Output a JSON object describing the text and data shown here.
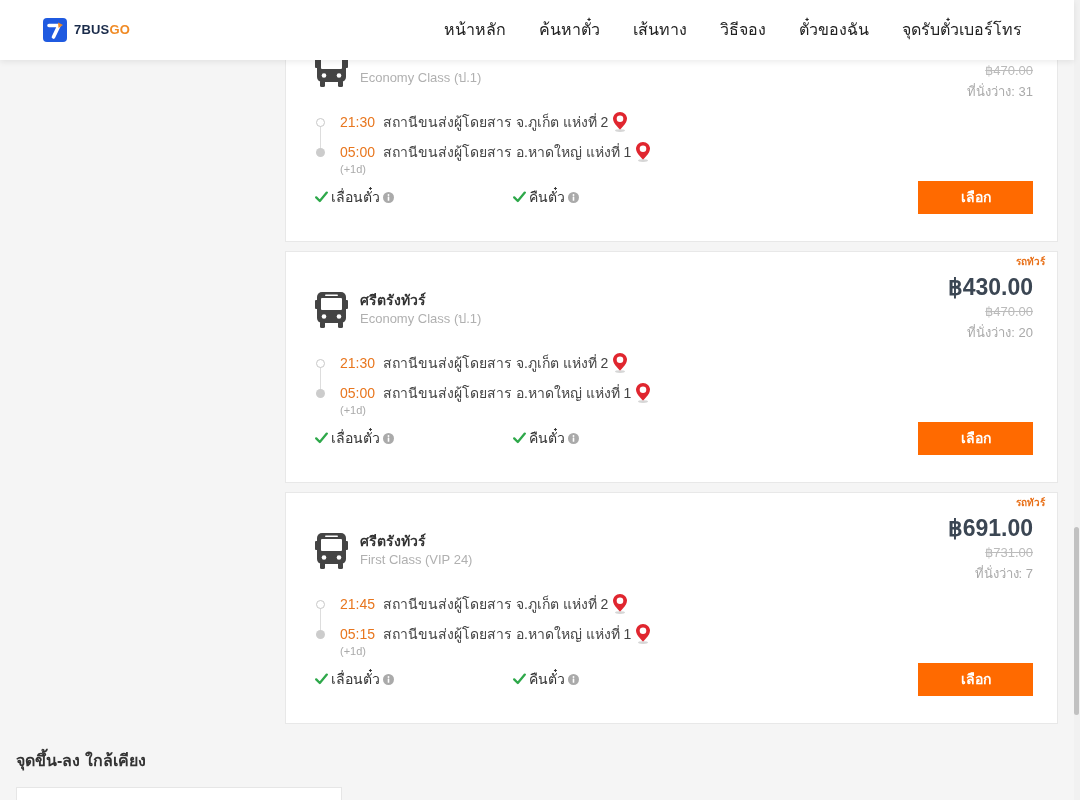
{
  "header": {
    "logo": {
      "brand": "7BUS",
      "accent": "GO"
    },
    "nav": [
      {
        "label": "หน้าหลัก"
      },
      {
        "label": "ค้นหาตั๋ว"
      },
      {
        "label": "เส้นทาง"
      },
      {
        "label": "วิธีจอง"
      },
      {
        "label": "ตั๋วของฉัน"
      },
      {
        "label": "จุดรับตั๋วเบอร์โทร"
      }
    ]
  },
  "trips": [
    {
      "class": "Economy Class (ป.1)",
      "original_price": "฿470.00",
      "seats": "ที่นั่งว่าง: 31",
      "stops": [
        {
          "kind": "departure",
          "time": "21:30",
          "station": "สถานีขนส่งผู้โดยสาร จ.ภูเก็ต แห่งที่ 2"
        },
        {
          "kind": "arrival",
          "time": "05:00",
          "station": "สถานีขนส่งผู้โดยสาร อ.หาดใหญ่ แห่งที่ 1",
          "day_offset": "(+1d)"
        }
      ],
      "features": [
        {
          "label": "เลื่อนตั๋ว",
          "available": true
        },
        {
          "label": "คืนตั๋ว",
          "available": true
        }
      ],
      "button": "เลือก"
    },
    {
      "tag": "รถทัวร์",
      "operator": "ศรีตรังทัวร์",
      "class": "Economy Class (ป.1)",
      "price": "฿430.00",
      "original_price": "฿470.00",
      "seats": "ที่นั่งว่าง: 20",
      "stops": [
        {
          "kind": "departure",
          "time": "21:30",
          "station": "สถานีขนส่งผู้โดยสาร จ.ภูเก็ต แห่งที่ 2"
        },
        {
          "kind": "arrival",
          "time": "05:00",
          "station": "สถานีขนส่งผู้โดยสาร อ.หาดใหญ่ แห่งที่ 1",
          "day_offset": "(+1d)"
        }
      ],
      "features": [
        {
          "label": "เลื่อนตั๋ว",
          "available": true
        },
        {
          "label": "คืนตั๋ว",
          "available": true
        }
      ],
      "button": "เลือก"
    },
    {
      "tag": "รถทัวร์",
      "operator": "ศรีตรังทัวร์",
      "class": "First Class (VIP 24)",
      "price": "฿691.00",
      "original_price": "฿731.00",
      "seats": "ที่นั่งว่าง: 7",
      "stops": [
        {
          "kind": "departure",
          "time": "21:45",
          "station": "สถานีขนส่งผู้โดยสาร จ.ภูเก็ต แห่งที่ 2"
        },
        {
          "kind": "arrival",
          "time": "05:15",
          "station": "สถานีขนส่งผู้โดยสาร อ.หาดใหญ่ แห่งที่ 1",
          "day_offset": "(+1d)"
        }
      ],
      "features": [
        {
          "label": "เลื่อนตั๋ว",
          "available": true
        },
        {
          "label": "คืนตั๋ว",
          "available": true
        }
      ],
      "button": "เลือก"
    }
  ],
  "nearby": {
    "title": "จุดขึ้น-ลง ใกล้เคียง"
  }
}
